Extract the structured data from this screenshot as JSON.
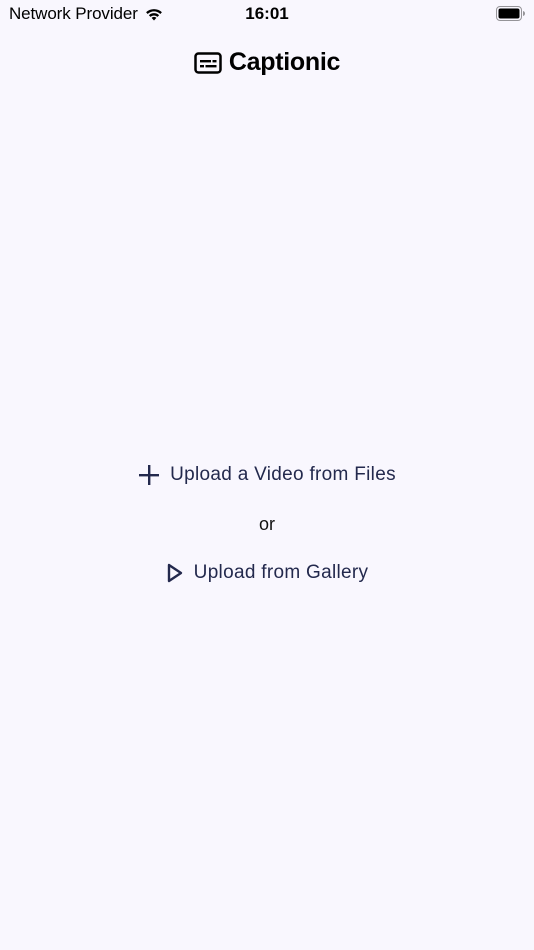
{
  "status_bar": {
    "carrier": "Network Provider",
    "time": "16:01",
    "wifi_icon": "wifi-icon",
    "battery_icon": "battery-icon"
  },
  "header": {
    "logo_icon": "captions-icon",
    "title": "Captionic"
  },
  "actions": {
    "upload_files_label": "Upload a Video from Files",
    "upload_files_icon": "plus-icon",
    "separator": "or",
    "upload_gallery_label": "Upload from Gallery",
    "upload_gallery_icon": "play-icon"
  },
  "colors": {
    "background": "#f9f7fe",
    "action_text": "#23294d"
  }
}
